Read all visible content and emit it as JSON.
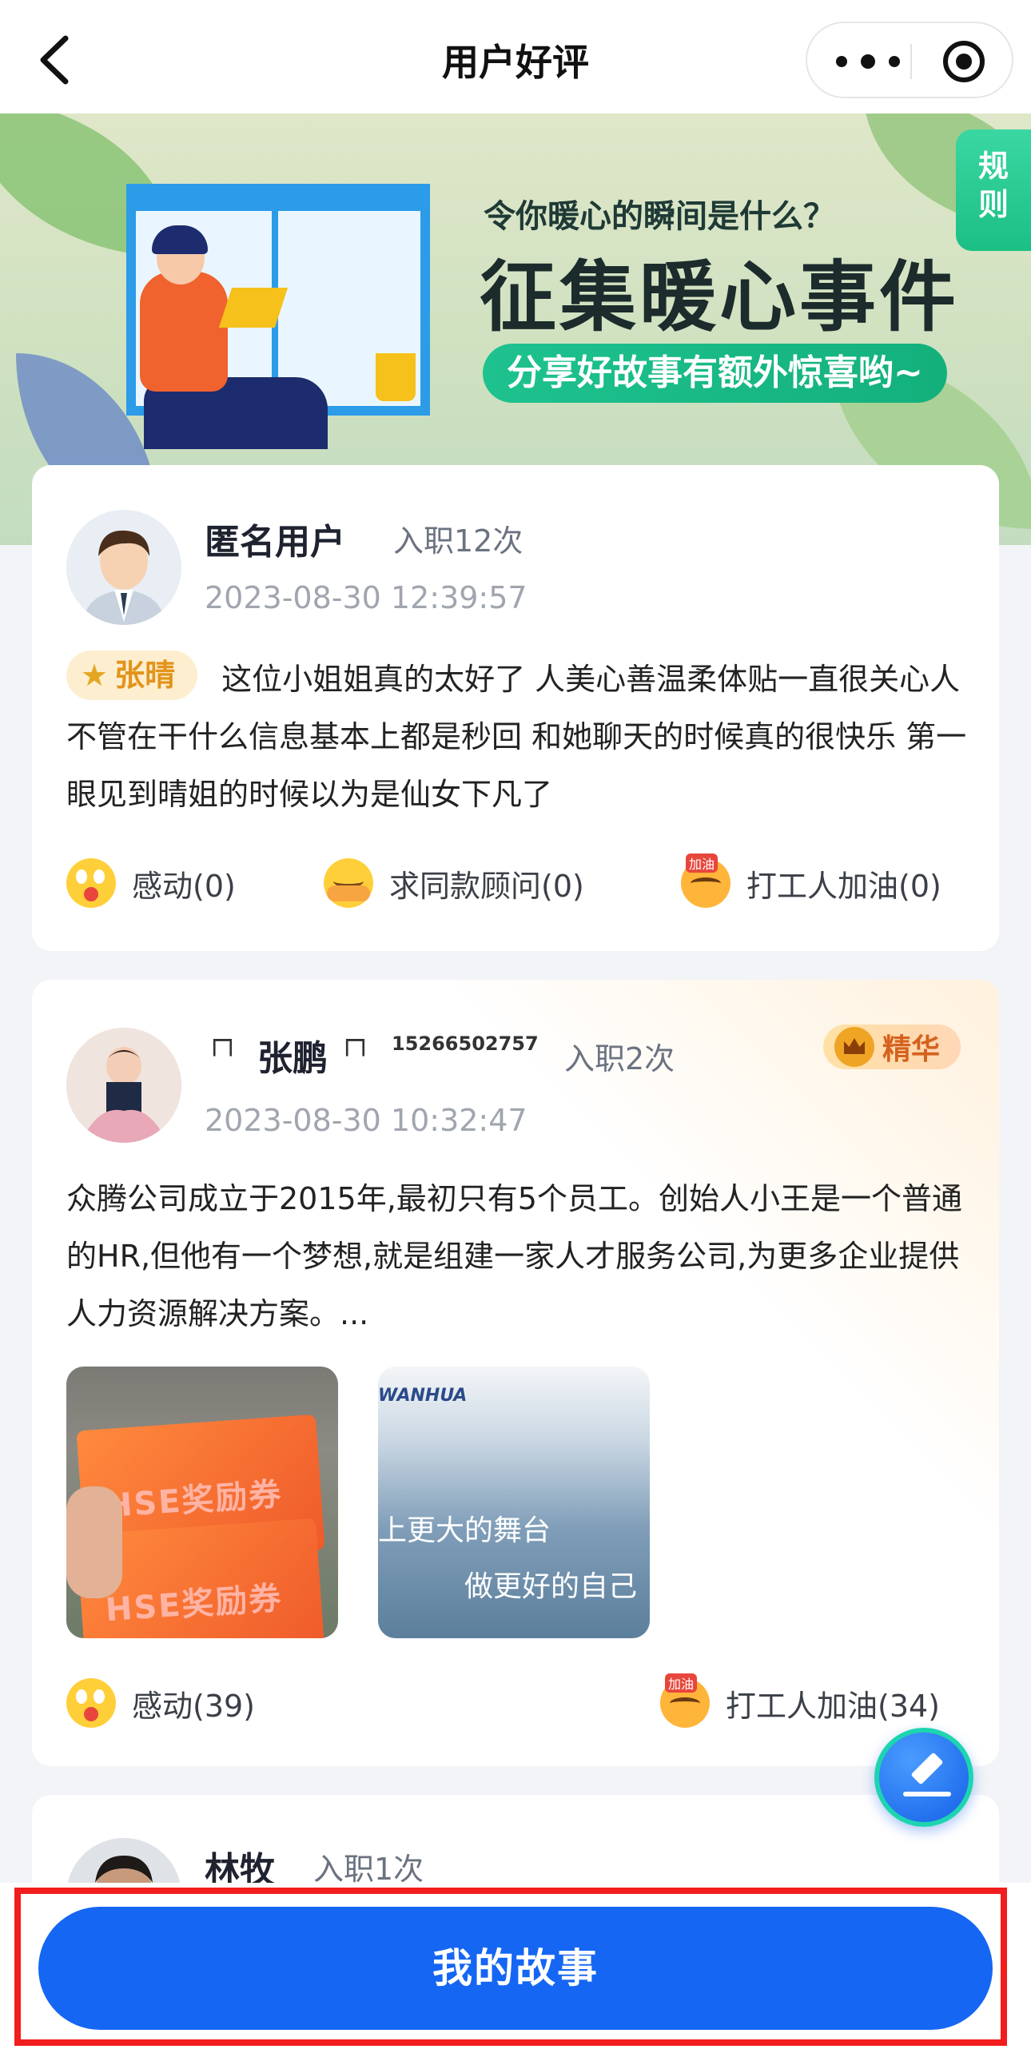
{
  "nav": {
    "title": "用户好评"
  },
  "banner": {
    "subtitle": "令你暖心的瞬间是什么？",
    "title": "征集暖心事件",
    "pill": "分享好故事有额外惊喜哟~",
    "rule_tab": "规\n则"
  },
  "posts": [
    {
      "name": "匿名用户",
      "jobs": "入职12次",
      "time": "2023-08-30 12:39:57",
      "tag": "张晴",
      "text": "这位小姐姐真的太好了 人美心善温柔体贴一直很关心人不管在干什么信息基本上都是秒回 和她聊天的时候真的很快乐 第一眼见到晴姐的时候以为是仙女下凡了",
      "reactions": [
        {
          "label": "感动(0)",
          "icon": "astonished-emoji-icon"
        },
        {
          "label": "求同款顾问(0)",
          "icon": "hugging-emoji-icon"
        },
        {
          "label": "打工人加油(0)",
          "icon": "cheer-emoji-icon"
        }
      ]
    },
    {
      "name": "张鹏",
      "corner_left": "┌┐",
      "corner_right": "┌┐",
      "phone": "15266502757",
      "jobs": "入职2次",
      "time": "2023-08-30 10:32:47",
      "badge": "精华",
      "text": "众腾公司成立于2015年,最初只有5个员工。创始人小王是一个普通的HR,但他有一个梦想,就是组建一家人才服务公司,为更多企业提供人力资源解决方案。...",
      "photo1": {
        "voucher_text": "HSE奖励券"
      },
      "photo2": {
        "brand": "WANHUA",
        "line1": "上更大的舞台",
        "line2": "做更好的自己"
      },
      "reactions": [
        {
          "label": "感动(39)",
          "icon": "astonished-emoji-icon"
        },
        {
          "label": "打工人加油(34)",
          "icon": "cheer-emoji-icon"
        }
      ]
    },
    {
      "name": "林牧",
      "jobs": "入职1次"
    }
  ],
  "bottom": {
    "button_label": "我的故事"
  },
  "colors": {
    "primary": "#1566f3",
    "highlight_box": "#f21d1d",
    "badge_text": "#d4621e",
    "tag_text": "#e2941a",
    "banner_pill": "#1ec28f"
  }
}
